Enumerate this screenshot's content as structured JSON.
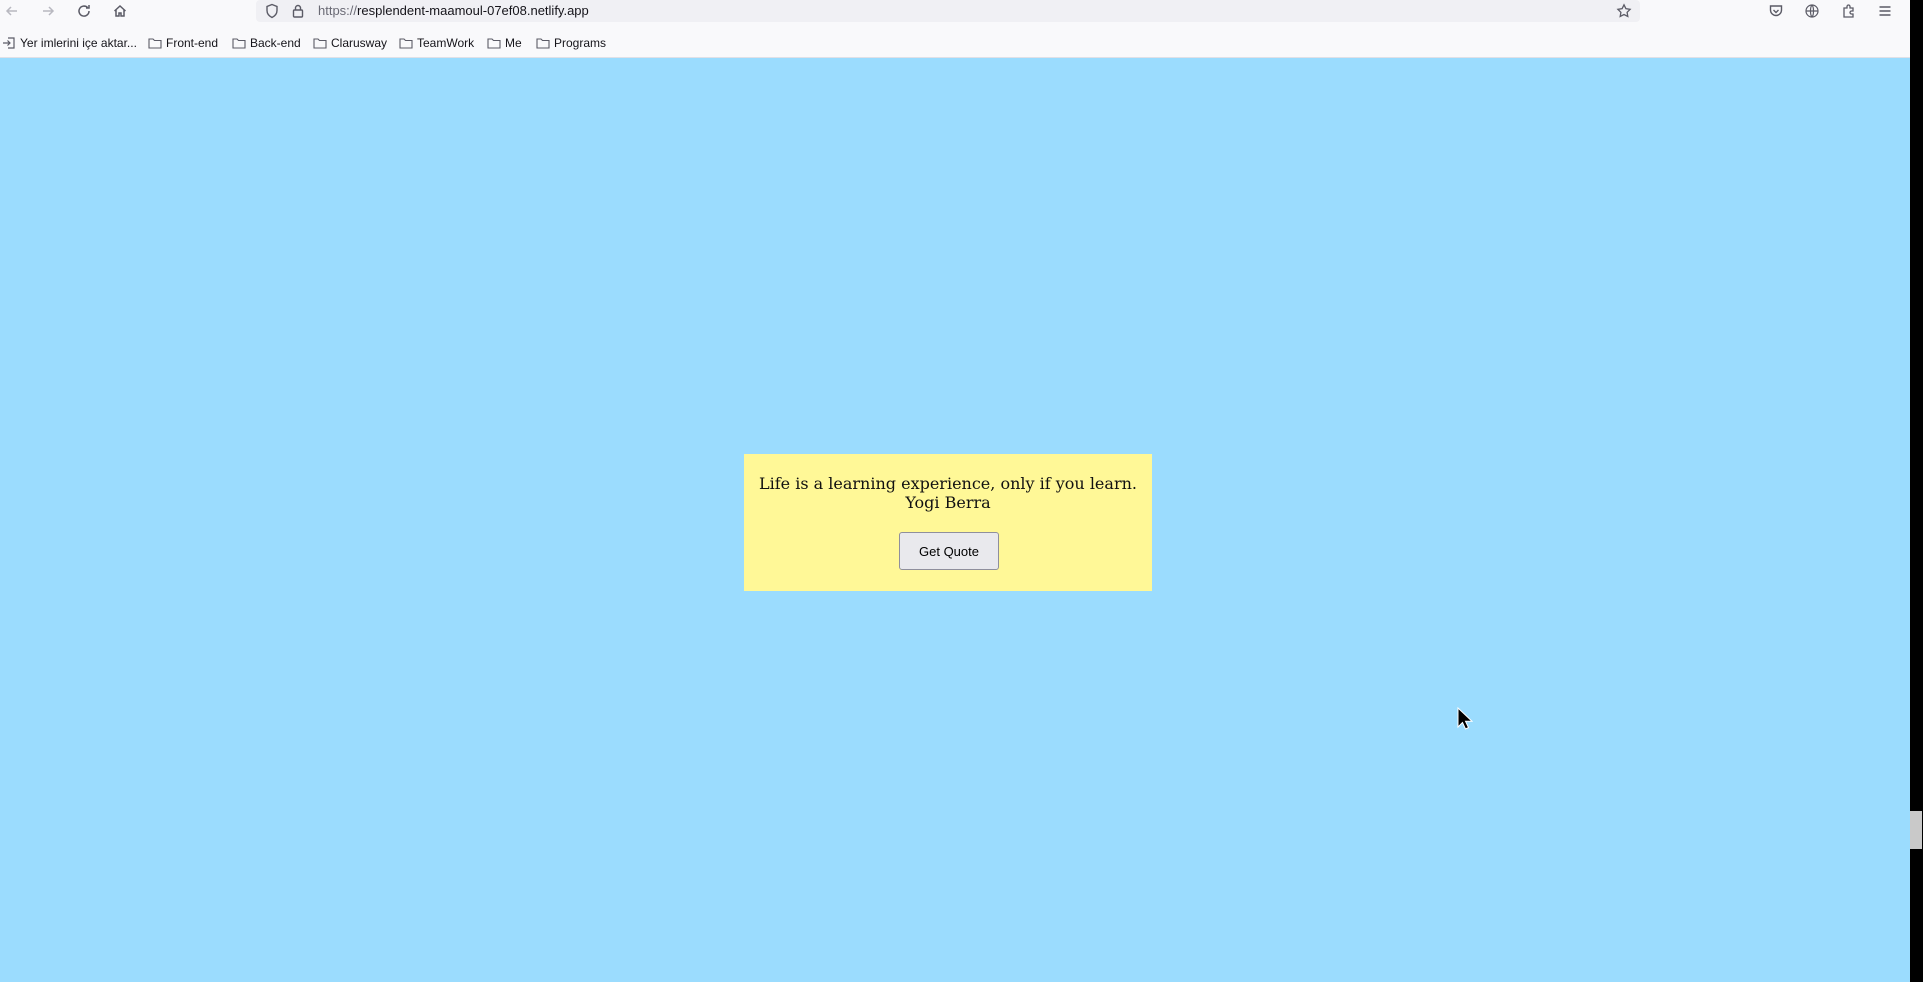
{
  "browser": {
    "url_scheme": "https://",
    "url_host": "resplendent-maamoul-07ef08.netlify.app"
  },
  "bookmarks": [
    {
      "label": "Yer imlerini içe aktar...",
      "icon": "import-icon"
    },
    {
      "label": "Front-end",
      "icon": "folder-icon"
    },
    {
      "label": "Back-end",
      "icon": "folder-icon"
    },
    {
      "label": "Clarusway",
      "icon": "folder-icon"
    },
    {
      "label": "TeamWork",
      "icon": "folder-icon"
    },
    {
      "label": "Me",
      "icon": "folder-icon"
    },
    {
      "label": "Programs",
      "icon": "folder-icon"
    }
  ],
  "page": {
    "background": "#9bdcfe",
    "quote": {
      "text": "Life is a learning experience, only if you learn.",
      "author": "Yogi Berra",
      "button_label": "Get Quote",
      "background": "#fff897"
    }
  }
}
